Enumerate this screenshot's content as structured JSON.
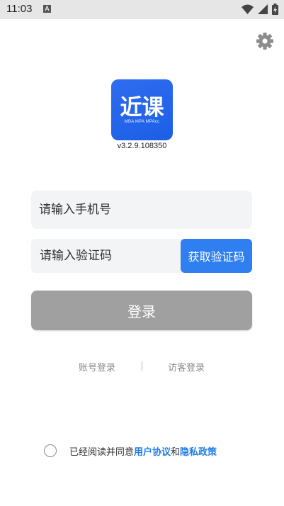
{
  "status_bar": {
    "time": "11:03",
    "notification_letter": "A"
  },
  "icons": {
    "settings": "gear-icon",
    "wifi": "wifi-icon",
    "signal": "signal-icon",
    "battery": "battery-charging-icon"
  },
  "logo": {
    "title": "近课",
    "subtitle": "MBA MPA MPAcc"
  },
  "version": "v3.2.9.108350",
  "form": {
    "phone_placeholder": "请输入手机号",
    "code_placeholder": "请输入验证码",
    "get_code_label": "获取验证码",
    "login_label": "登录"
  },
  "alt_login": {
    "account": "账号登录",
    "visitor": "访客登录"
  },
  "agreement": {
    "prefix": "已经阅读并同意",
    "user_agreement": "用户协议",
    "and": "和",
    "privacy_policy": "隐私政策"
  },
  "colors": {
    "primary": "#2f7ff0",
    "login_disabled": "#a0a0a0",
    "link": "#1f7ee8"
  }
}
